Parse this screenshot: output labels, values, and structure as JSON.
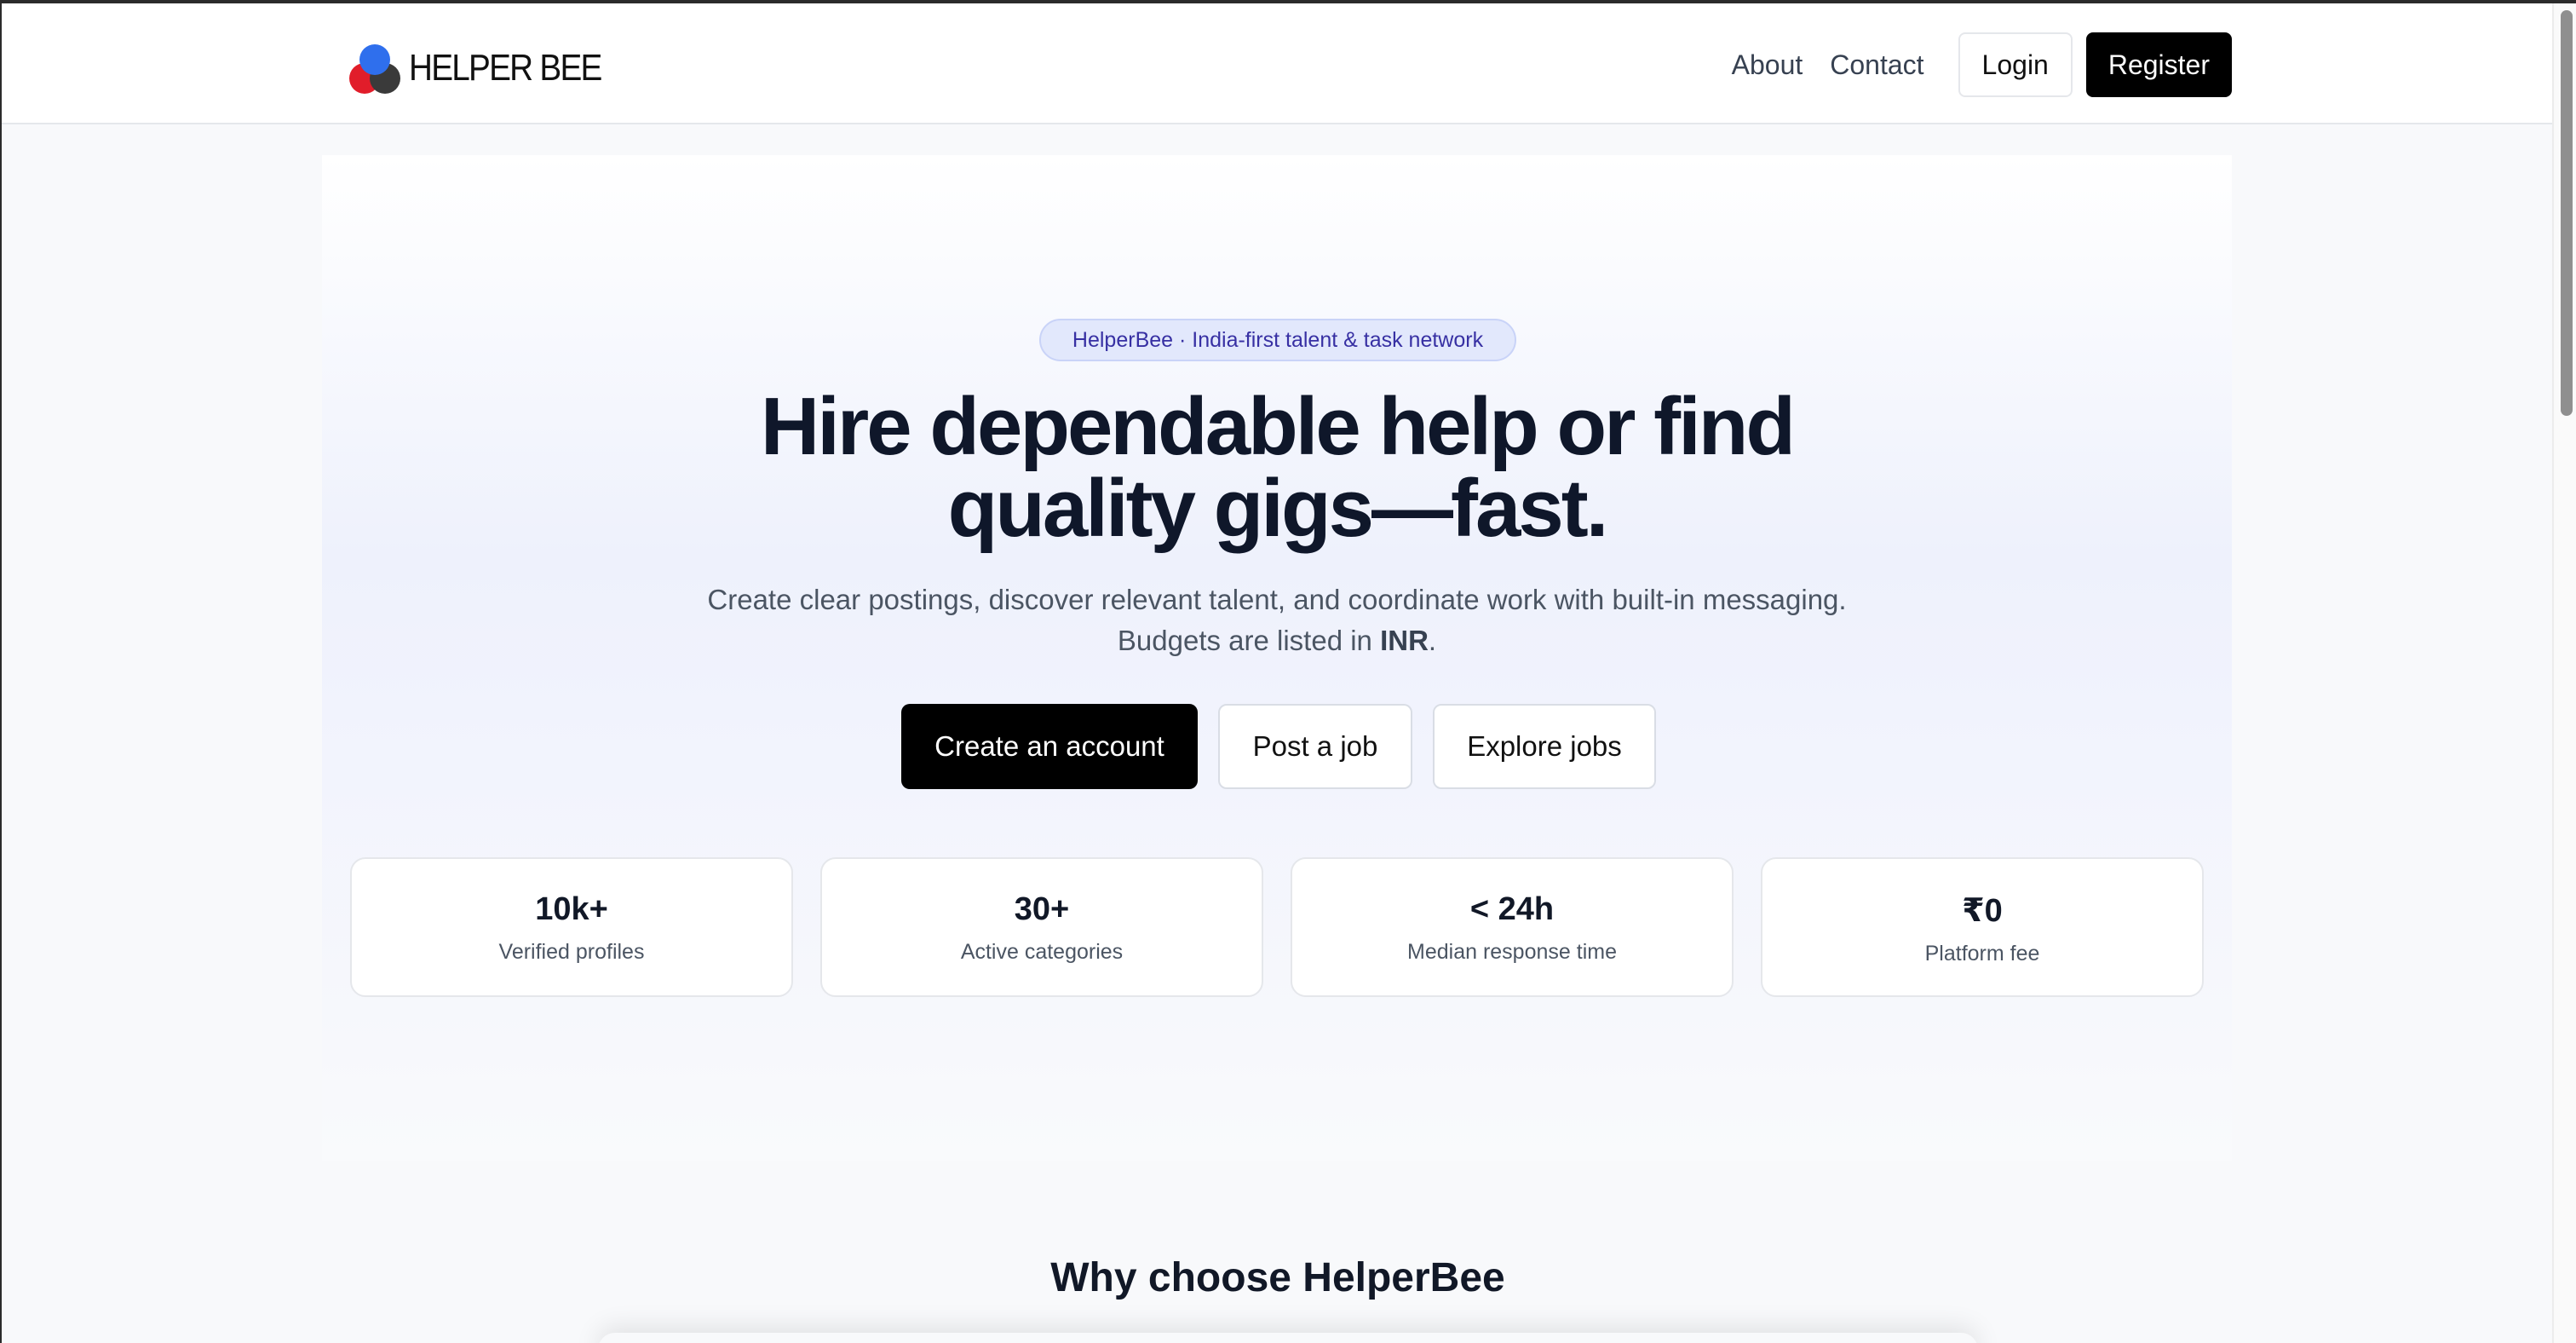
{
  "nav": {
    "brand": "HELPER BEE",
    "links": {
      "about": "About",
      "contact": "Contact"
    },
    "login": "Login",
    "register": "Register"
  },
  "hero": {
    "pill": "HelperBee · India-first talent & task network",
    "title_line1": "Hire dependable help or find",
    "title_line2": "quality gigs—fast.",
    "subtitle_line1": "Create clear postings, discover relevant talent, and coordinate work with built-in messaging.",
    "subtitle_line2_prefix": "Budgets are listed in ",
    "subtitle_line2_bold": "INR",
    "subtitle_line2_suffix": ".",
    "cta": {
      "create": "Create an account",
      "post": "Post a job",
      "explore": "Explore jobs"
    },
    "stats": [
      {
        "value": "10k+",
        "label": "Verified profiles"
      },
      {
        "value": "30+",
        "label": "Active categories"
      },
      {
        "value": "< 24h",
        "label": "Median response time"
      },
      {
        "value": "₹0",
        "label": "Platform fee"
      }
    ]
  },
  "why": {
    "title": "Why choose HelperBee"
  },
  "colors": {
    "accent": "#000000",
    "pill_bg": "#e2e8fc",
    "pill_text": "#3730a3",
    "logo_red": "#e11d2a",
    "logo_blue": "#2f6fed",
    "logo_dark": "#3a3a3a"
  }
}
